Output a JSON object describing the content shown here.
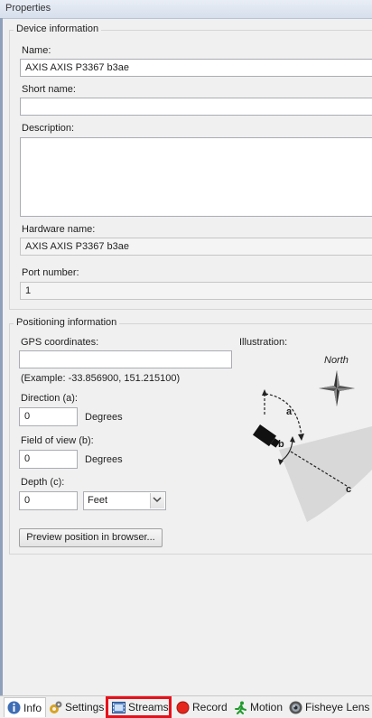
{
  "window": {
    "title": "Properties"
  },
  "device_info": {
    "legend": "Device information",
    "name_label": "Name:",
    "name_value": "AXIS AXIS P3367 b3ae",
    "short_name_label": "Short name:",
    "short_name_value": "",
    "description_label": "Description:",
    "description_value": "",
    "hardware_label": "Hardware name:",
    "hardware_value": "AXIS AXIS P3367 b3ae",
    "port_label": "Port number:",
    "port_value": "1"
  },
  "positioning": {
    "legend": "Positioning information",
    "gps_label": "GPS coordinates:",
    "gps_value": "",
    "gps_example": "(Example: -33.856900, 151.215100)",
    "direction_label": "Direction (a):",
    "direction_value": "0",
    "direction_unit": "Degrees",
    "fov_label": "Field of view (b):",
    "fov_value": "0",
    "fov_unit": "Degrees",
    "depth_label": "Depth (c):",
    "depth_value": "0",
    "depth_unit": "Feet",
    "preview_button": "Preview position in browser...",
    "illustration_label": "Illustration:",
    "north_label": "North",
    "label_a": "a",
    "label_b": "b",
    "label_c": "c"
  },
  "tabs": [
    {
      "label": "Info",
      "icon": "info-icon"
    },
    {
      "label": "Settings",
      "icon": "settings-icon"
    },
    {
      "label": "Streams",
      "icon": "streams-icon"
    },
    {
      "label": "Record",
      "icon": "record-icon"
    },
    {
      "label": "Motion",
      "icon": "motion-icon"
    },
    {
      "label": "Fisheye Lens",
      "icon": "fisheye-lens-icon"
    }
  ],
  "colors": {
    "highlight": "#e8101a",
    "accent": "#3d6db5",
    "record": "#e4261c",
    "motion": "#1f9a2c"
  }
}
